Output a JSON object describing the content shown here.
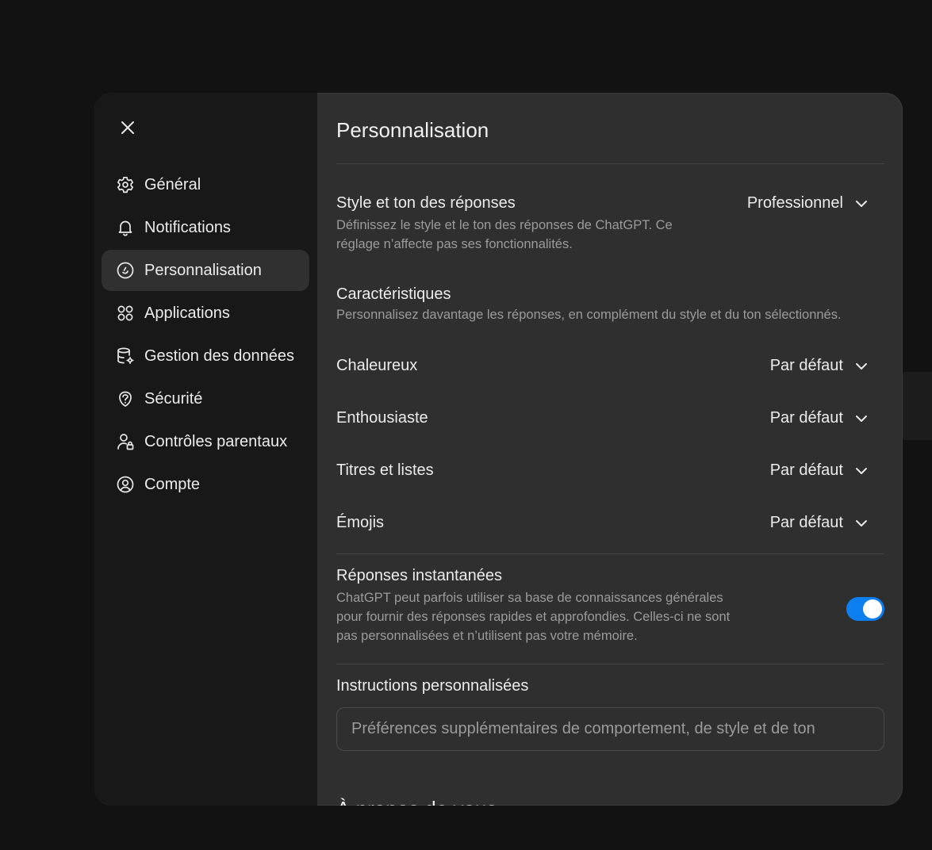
{
  "sidebar": {
    "close_icon": "close-icon",
    "items": [
      {
        "label": "Général",
        "icon": "gear-icon"
      },
      {
        "label": "Notifications",
        "icon": "bell-icon"
      },
      {
        "label": "Personnalisation",
        "icon": "personalization-icon",
        "active": true
      },
      {
        "label": "Applications",
        "icon": "apps-grid-icon"
      },
      {
        "label": "Gestion des données",
        "icon": "database-icon"
      },
      {
        "label": "Sécurité",
        "icon": "security-icon"
      },
      {
        "label": "Contrôles parentaux",
        "icon": "parental-controls-icon"
      },
      {
        "label": "Compte",
        "icon": "account-icon"
      }
    ]
  },
  "main": {
    "title": "Personnalisation",
    "style_tone": {
      "title": "Style et ton des réponses",
      "description": "Définissez le style et le ton des réponses de ChatGPT. Ce réglage n’affecte pas ses fonctionnalités.",
      "value": "Professionnel"
    },
    "characteristics": {
      "title": "Caractéristiques",
      "description": "Personnalisez davantage les réponses, en complément du style et du ton sélectionnés.",
      "items": [
        {
          "label": "Chaleureux",
          "value": "Par défaut"
        },
        {
          "label": "Enthousiaste",
          "value": "Par défaut"
        },
        {
          "label": "Titres et listes",
          "value": "Par défaut"
        },
        {
          "label": "Émojis",
          "value": "Par défaut"
        }
      ]
    },
    "instant_answers": {
      "title": "Réponses instantanées",
      "description": "ChatGPT peut parfois utiliser sa base de connaissances générales pour fournir des réponses rapides et approfondies. Celles-ci ne sont pas personnalisées et n’utilisent pas votre mémoire.",
      "enabled": true
    },
    "custom_instructions": {
      "title": "Instructions personnalisées",
      "placeholder": "Préférences supplémentaires de comportement, de style et de ton",
      "value": ""
    },
    "about_you": {
      "title": "À propos de vous"
    }
  },
  "colors": {
    "accent": "#0b7ff0",
    "sidebar_bg": "#181818",
    "content_bg": "#2f2f2f",
    "active_item_bg": "#303030"
  }
}
